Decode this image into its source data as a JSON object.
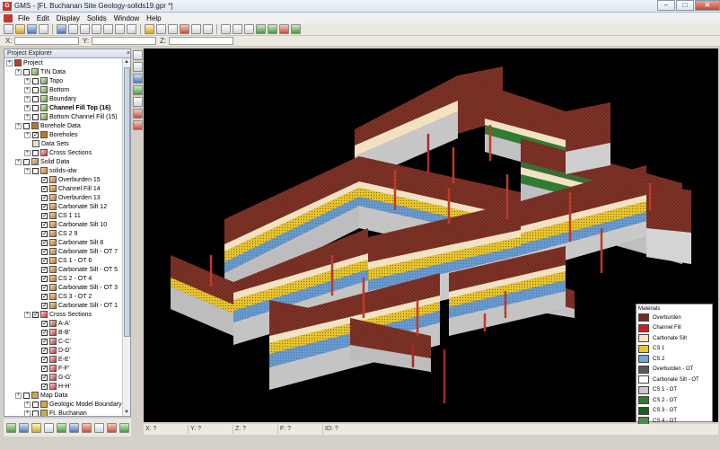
{
  "window": {
    "title": "GMS - [Ft. Buchanan Site Geology-solids19.gpr *]"
  },
  "menu": [
    "File",
    "Edit",
    "Display",
    "Solids",
    "Window",
    "Help"
  ],
  "coords": {
    "x_label": "X:",
    "y_label": "Y:",
    "z_label": "Z:"
  },
  "explorer": {
    "title": "Project Explorer",
    "items": [
      {
        "label": "Project",
        "depth": 0,
        "icon": "proj",
        "exp": true,
        "cb": false
      },
      {
        "label": "TIN Data",
        "depth": 1,
        "icon": "tin",
        "exp": true,
        "cb": true
      },
      {
        "label": "Topo",
        "depth": 2,
        "icon": "tin",
        "exp": true,
        "cb": true
      },
      {
        "label": "Bottom",
        "depth": 2,
        "icon": "tin",
        "exp": true,
        "cb": true
      },
      {
        "label": "Boundary",
        "depth": 2,
        "icon": "tin",
        "exp": true,
        "cb": true
      },
      {
        "label": "Channel Fill Top (16)",
        "depth": 2,
        "icon": "tin",
        "exp": true,
        "cb": true,
        "bold": true
      },
      {
        "label": "Bottom Channel Fill (15)",
        "depth": 2,
        "icon": "tin",
        "exp": true,
        "cb": true
      },
      {
        "label": "Borehole Data",
        "depth": 1,
        "icon": "bore",
        "exp": true,
        "cb": true
      },
      {
        "label": "Boreholes",
        "depth": 2,
        "icon": "bore",
        "exp": true,
        "cb": true,
        "checked": true
      },
      {
        "label": "Data Sets",
        "depth": 2,
        "icon": "data",
        "exp": false,
        "cb": false
      },
      {
        "label": "Cross Sections",
        "depth": 2,
        "icon": "xs",
        "exp": true,
        "cb": true
      },
      {
        "label": "Solid Data",
        "depth": 1,
        "icon": "solid",
        "exp": true,
        "cb": true
      },
      {
        "label": "solids-idw",
        "depth": 2,
        "icon": "solid",
        "exp": true,
        "cb": true
      },
      {
        "label": "Overburden 15",
        "depth": 3,
        "icon": "solid",
        "exp": false,
        "cb": true,
        "checked": true
      },
      {
        "label": "Channel Fill 14",
        "depth": 3,
        "icon": "solid",
        "exp": false,
        "cb": true,
        "checked": true
      },
      {
        "label": "Overburden 13",
        "depth": 3,
        "icon": "solid",
        "exp": false,
        "cb": true,
        "checked": true
      },
      {
        "label": "Carbonate Silt 12",
        "depth": 3,
        "icon": "solid",
        "exp": false,
        "cb": true,
        "checked": true
      },
      {
        "label": "CS 1 11",
        "depth": 3,
        "icon": "solid",
        "exp": false,
        "cb": true,
        "checked": true
      },
      {
        "label": "Carbonate Silt 10",
        "depth": 3,
        "icon": "solid",
        "exp": false,
        "cb": true,
        "checked": true
      },
      {
        "label": "CS 2 9",
        "depth": 3,
        "icon": "solid",
        "exp": false,
        "cb": true,
        "checked": true
      },
      {
        "label": "Carbonate Silt 8",
        "depth": 3,
        "icon": "solid",
        "exp": false,
        "cb": true,
        "checked": true
      },
      {
        "label": "Carbonate Silt - OT 7",
        "depth": 3,
        "icon": "solid",
        "exp": false,
        "cb": true,
        "checked": true
      },
      {
        "label": "CS 1 - OT 6",
        "depth": 3,
        "icon": "solid",
        "exp": false,
        "cb": true,
        "checked": true
      },
      {
        "label": "Carbonate Silt - OT 5",
        "depth": 3,
        "icon": "solid",
        "exp": false,
        "cb": true,
        "checked": true
      },
      {
        "label": "CS 2 - OT 4",
        "depth": 3,
        "icon": "solid",
        "exp": false,
        "cb": true,
        "checked": true
      },
      {
        "label": "Carbonate Silt - OT 3",
        "depth": 3,
        "icon": "solid",
        "exp": false,
        "cb": true,
        "checked": true
      },
      {
        "label": "CS 3 - OT 2",
        "depth": 3,
        "icon": "solid",
        "exp": false,
        "cb": true,
        "checked": true
      },
      {
        "label": "Carbonate Silt - OT 1",
        "depth": 3,
        "icon": "solid",
        "exp": false,
        "cb": true,
        "checked": true
      },
      {
        "label": "Cross Sections",
        "depth": 2,
        "icon": "xs",
        "exp": true,
        "cb": true,
        "checked": true
      },
      {
        "label": "A-A'",
        "depth": 3,
        "icon": "xs",
        "exp": false,
        "cb": true,
        "checked": true
      },
      {
        "label": "B-B'",
        "depth": 3,
        "icon": "xs",
        "exp": false,
        "cb": true,
        "checked": true
      },
      {
        "label": "C-C'",
        "depth": 3,
        "icon": "xs",
        "exp": false,
        "cb": true,
        "checked": true
      },
      {
        "label": "D-D'",
        "depth": 3,
        "icon": "xs",
        "exp": false,
        "cb": true,
        "checked": true
      },
      {
        "label": "E-E'",
        "depth": 3,
        "icon": "xs",
        "exp": false,
        "cb": true,
        "checked": true
      },
      {
        "label": "F-F'",
        "depth": 3,
        "icon": "xs",
        "exp": false,
        "cb": true,
        "checked": true
      },
      {
        "label": "G-G'",
        "depth": 3,
        "icon": "xs",
        "exp": false,
        "cb": true,
        "checked": true
      },
      {
        "label": "H-H'",
        "depth": 3,
        "icon": "xs",
        "exp": false,
        "cb": true,
        "checked": true
      },
      {
        "label": "Map Data",
        "depth": 1,
        "icon": "map",
        "exp": true,
        "cb": true
      },
      {
        "label": "Geologic Model Boundary",
        "depth": 2,
        "icon": "map",
        "exp": true,
        "cb": true
      },
      {
        "label": "Ft. Buchanan",
        "depth": 2,
        "icon": "map",
        "exp": true,
        "cb": true
      }
    ]
  },
  "status": {
    "x": "X: ?",
    "y": "Y: ?",
    "z": "Z: ?",
    "f": "F: ?",
    "id": "ID: ?"
  },
  "legend": {
    "title": "Materials",
    "items": [
      {
        "label": "Overburden",
        "color": "#7a2a1e"
      },
      {
        "label": "Channel Fill",
        "color": "#d11f1f"
      },
      {
        "label": "Carbonate Silt",
        "color": "#f6e3c0"
      },
      {
        "label": "CS 1",
        "color": "#e8c630"
      },
      {
        "label": "CS 2",
        "color": "#6ea6d6"
      },
      {
        "label": "Overburden - OT",
        "color": "#595959"
      },
      {
        "label": "Carbonate Silt - OT",
        "color": "#ffffff"
      },
      {
        "label": "CS 1 - OT",
        "color": "#c9c9c9"
      },
      {
        "label": "CS 2 - OT",
        "color": "#2e7d32"
      },
      {
        "label": "CS 3 - OT",
        "color": "#1b5e20"
      },
      {
        "label": "CS 4 - OT",
        "color": "#4a8a4a"
      }
    ]
  }
}
